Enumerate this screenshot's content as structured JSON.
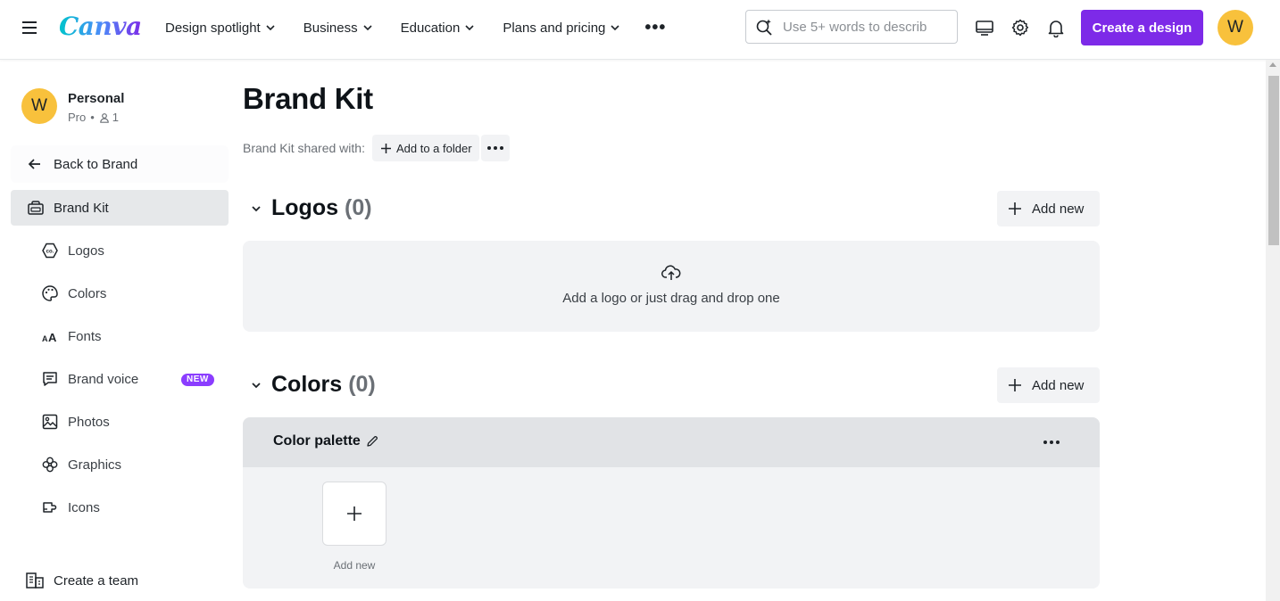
{
  "header": {
    "logo_text": "Canva",
    "nav": [
      {
        "label": "Design spotlight"
      },
      {
        "label": "Business"
      },
      {
        "label": "Education"
      },
      {
        "label": "Plans and pricing"
      }
    ],
    "more_label": "•••",
    "search": {
      "placeholder": "Use 5+ words to describ",
      "value": ""
    },
    "create_label": "Create a design",
    "avatar_initial": "W",
    "icons": [
      "menu-icon",
      "desktop-icon",
      "settings-icon",
      "bell-icon"
    ]
  },
  "sidebar": {
    "account": {
      "initial": "W",
      "name": "Personal",
      "plan": "Pro",
      "separator": "•",
      "members": "1"
    },
    "back_label": "Back to Brand",
    "active_item": {
      "label": "Brand Kit",
      "icon": "brand-kit-icon"
    },
    "items": [
      {
        "label": "Logos",
        "icon": "logo-icon"
      },
      {
        "label": "Colors",
        "icon": "palette-icon"
      },
      {
        "label": "Fonts",
        "icon": "fonts-icon"
      },
      {
        "label": "Brand voice",
        "icon": "brand-voice-icon",
        "badge": "NEW"
      },
      {
        "label": "Photos",
        "icon": "photo-icon"
      },
      {
        "label": "Graphics",
        "icon": "graphics-icon"
      },
      {
        "label": "Icons",
        "icon": "icons-icon"
      }
    ],
    "team_label": "Create a team"
  },
  "main": {
    "title": "Brand Kit",
    "shared_label": "Brand Kit shared with:",
    "add_folder_label": "Add to a folder",
    "logos": {
      "title": "Logos",
      "count": "(0)",
      "add_label": "Add new",
      "drop_text": "Add a logo or just drag and drop one"
    },
    "colors": {
      "title": "Colors",
      "count": "(0)",
      "add_label": "Add new",
      "palette_name": "Color palette",
      "add_swatch_label": "Add new"
    }
  },
  "colors": {
    "accent": "#7d2ae8",
    "avatar": "#f8c13c",
    "badge": "#8b3dff",
    "active_bg": "#e6e8ea"
  }
}
